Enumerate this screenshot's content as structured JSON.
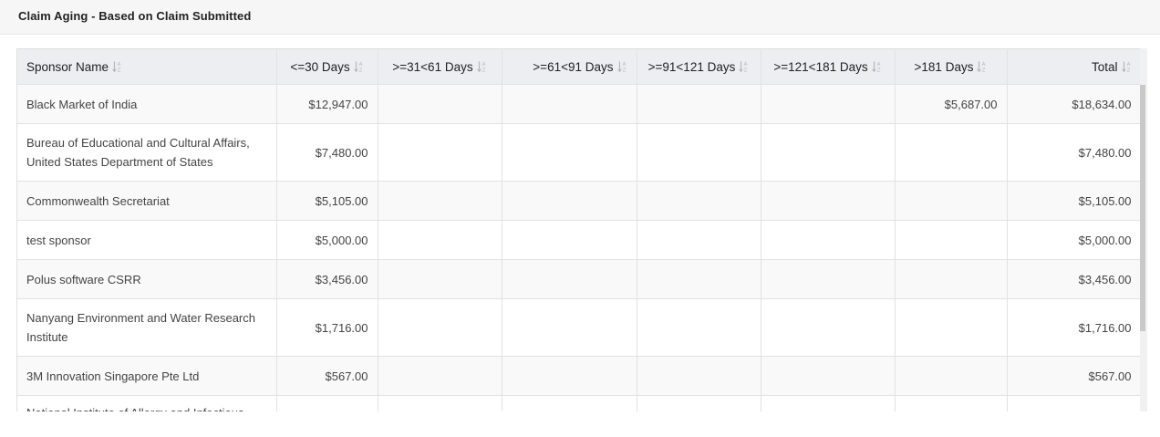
{
  "card": {
    "title": "Claim Aging - Based on Claim Submitted"
  },
  "table": {
    "columns": [
      {
        "label": "Sponsor Name"
      },
      {
        "label": "<=30 Days"
      },
      {
        "label": ">=31<61 Days"
      },
      {
        "label": ">=61<91 Days"
      },
      {
        "label": ">=91<121 Days"
      },
      {
        "label": ">=121<181 Days"
      },
      {
        "label": ">181 Days"
      },
      {
        "label": "Total"
      }
    ],
    "rows": [
      {
        "cells": [
          "Black Market of India",
          "$12,947.00",
          "",
          "",
          "",
          "",
          "$5,687.00",
          "$18,634.00"
        ]
      },
      {
        "cells": [
          "Bureau of Educational and Cultural Affairs, United States Department of States",
          "$7,480.00",
          "",
          "",
          "",
          "",
          "",
          "$7,480.00"
        ]
      },
      {
        "cells": [
          "Commonwealth Secretariat",
          "$5,105.00",
          "",
          "",
          "",
          "",
          "",
          "$5,105.00"
        ]
      },
      {
        "cells": [
          "test sponsor",
          "$5,000.00",
          "",
          "",
          "",
          "",
          "",
          "$5,000.00"
        ]
      },
      {
        "cells": [
          "Polus software CSRR",
          "$3,456.00",
          "",
          "",
          "",
          "",
          "",
          "$3,456.00"
        ]
      },
      {
        "cells": [
          "Nanyang Environment and Water Research Institute",
          "$1,716.00",
          "",
          "",
          "",
          "",
          "",
          "$1,716.00"
        ]
      },
      {
        "cells": [
          "3M Innovation Singapore Pte Ltd",
          "$567.00",
          "",
          "",
          "",
          "",
          "",
          "$567.00"
        ]
      },
      {
        "cells": [
          "National Institute of Allergy and Infectious",
          "",
          "",
          "",
          "",
          "",
          "",
          ""
        ]
      }
    ]
  },
  "icons": {
    "sort": "sort-alpha-icon"
  },
  "colors": {
    "header_bg": "#eceef1",
    "stripe": "#f9f9f9",
    "border": "#e2e2e2",
    "icon": "#b8b8b8"
  }
}
